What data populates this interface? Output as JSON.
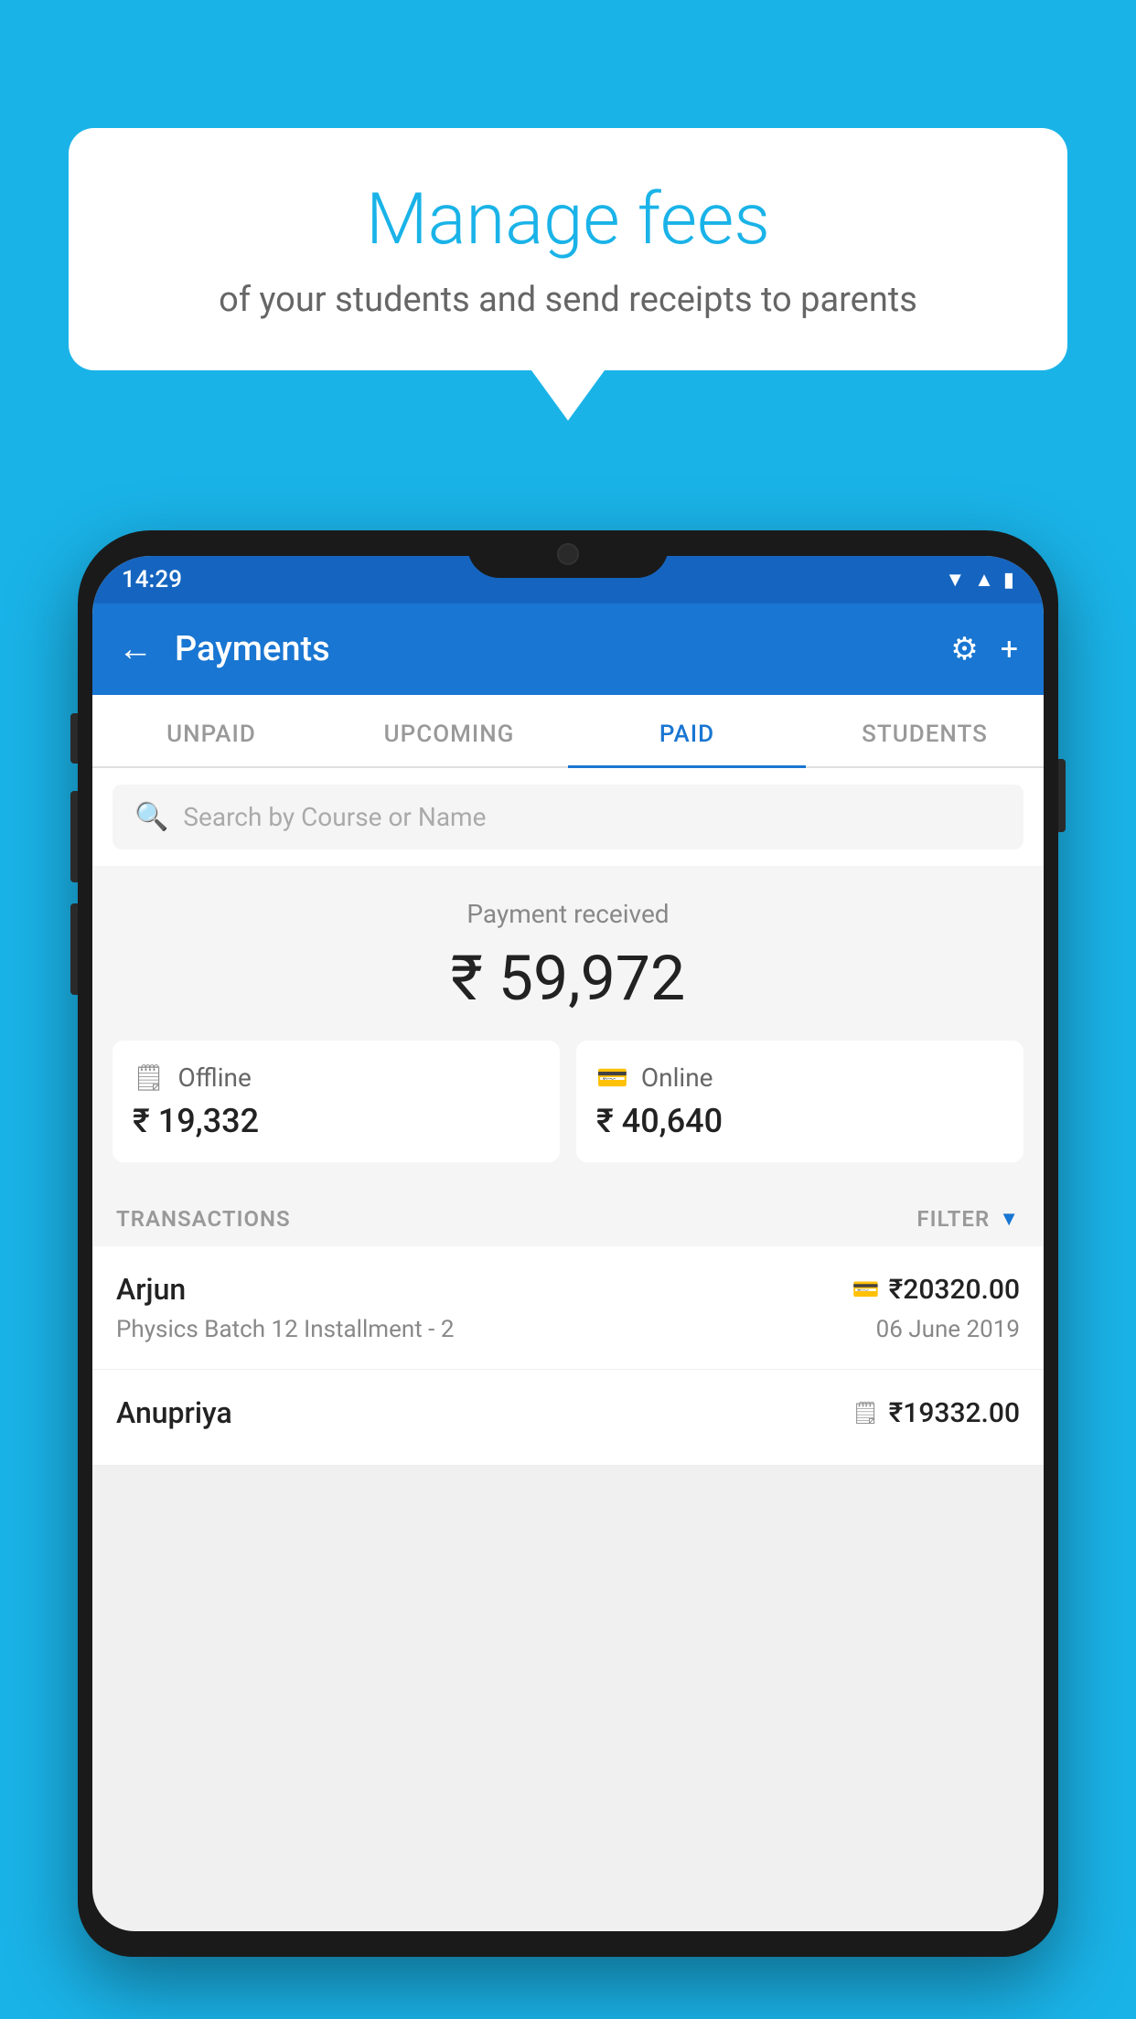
{
  "background": {
    "color": "#1ab3e8"
  },
  "speech_bubble": {
    "title": "Manage fees",
    "subtitle": "of your students and send receipts to parents"
  },
  "status_bar": {
    "time": "14:29",
    "wifi_icon": "▲",
    "signal_icon": "▲",
    "battery_icon": "▮"
  },
  "app_bar": {
    "title": "Payments",
    "back_icon": "←",
    "gear_icon": "⚙",
    "plus_icon": "+"
  },
  "tabs": [
    {
      "label": "UNPAID",
      "active": false
    },
    {
      "label": "UPCOMING",
      "active": false
    },
    {
      "label": "PAID",
      "active": true
    },
    {
      "label": "STUDENTS",
      "active": false
    }
  ],
  "search": {
    "placeholder": "Search by Course or Name"
  },
  "payment_summary": {
    "label": "Payment received",
    "amount": "₹ 59,972",
    "offline": {
      "icon": "📋",
      "label": "Offline",
      "amount": "₹ 19,332"
    },
    "online": {
      "icon": "💳",
      "label": "Online",
      "amount": "₹ 40,640"
    }
  },
  "transactions": {
    "label": "TRANSACTIONS",
    "filter_label": "FILTER",
    "items": [
      {
        "name": "Arjun",
        "amount": "₹20320.00",
        "payment_type": "card",
        "course": "Physics Batch 12 Installment - 2",
        "date": "06 June 2019"
      },
      {
        "name": "Anupriya",
        "amount": "₹19332.00",
        "payment_type": "cash",
        "course": "",
        "date": ""
      }
    ]
  }
}
